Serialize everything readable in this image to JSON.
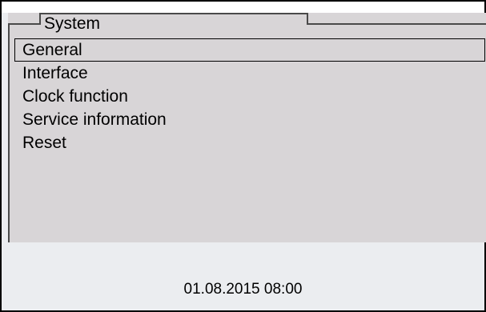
{
  "tab": {
    "title": "System"
  },
  "menu": {
    "items": [
      {
        "label": "General",
        "selected": true
      },
      {
        "label": "Interface",
        "selected": false
      },
      {
        "label": "Clock function",
        "selected": false
      },
      {
        "label": "Service information",
        "selected": false
      },
      {
        "label": "Reset",
        "selected": false
      }
    ]
  },
  "status": {
    "datetime": "01.08.2015 08:00"
  }
}
